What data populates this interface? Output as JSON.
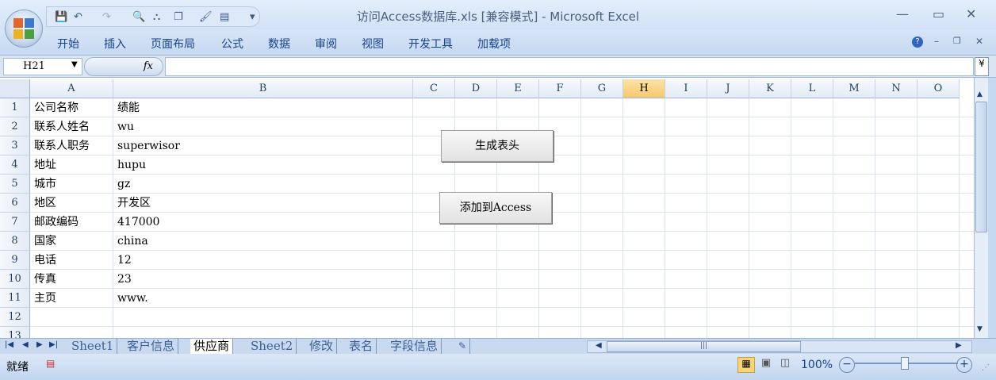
{
  "window": {
    "title": "访问Access数据库.xls  [兼容模式] - Microsoft Excel",
    "minimize": "—",
    "maximize": "▭",
    "close": "✕"
  },
  "ribbon_tabs": [
    "开始",
    "插入",
    "页面布局",
    "公式",
    "数据",
    "审阅",
    "视图",
    "开发工具",
    "加载项"
  ],
  "formula_bar": {
    "name_box": "H21",
    "fx": "fx",
    "value": ""
  },
  "columns": [
    "A",
    "B",
    "C",
    "D",
    "E",
    "F",
    "G",
    "H",
    "I",
    "J",
    "K",
    "L",
    "M",
    "N",
    "O"
  ],
  "selected_column": "H",
  "rows": [
    {
      "n": "1",
      "a": "公司名称",
      "b": "绩能"
    },
    {
      "n": "2",
      "a": "联系人姓名",
      "b": "wu"
    },
    {
      "n": "3",
      "a": "联系人职务",
      "b": "superwisor"
    },
    {
      "n": "4",
      "a": "地址",
      "b": "hupu"
    },
    {
      "n": "5",
      "a": "城市",
      "b": "gz"
    },
    {
      "n": "6",
      "a": "地区",
      "b": "开发区"
    },
    {
      "n": "7",
      "a": "邮政编码",
      "b": "417000"
    },
    {
      "n": "8",
      "a": "国家",
      "b": "china"
    },
    {
      "n": "9",
      "a": "电话",
      "b": "12"
    },
    {
      "n": "10",
      "a": "传真",
      "b": "23"
    },
    {
      "n": "11",
      "a": "主页",
      "b": "www."
    },
    {
      "n": "12",
      "a": "",
      "b": ""
    },
    {
      "n": "13",
      "a": "",
      "b": ""
    }
  ],
  "buttons": {
    "generate_header": "生成表头",
    "add_to_access": "添加到Access"
  },
  "sheet_tabs": [
    "Sheet1",
    "客户信息",
    "供应商",
    "Sheet2",
    "修改",
    "表名",
    "字段信息"
  ],
  "active_sheet": "供应商",
  "status": {
    "ready": "就绪",
    "zoom": "100%"
  }
}
